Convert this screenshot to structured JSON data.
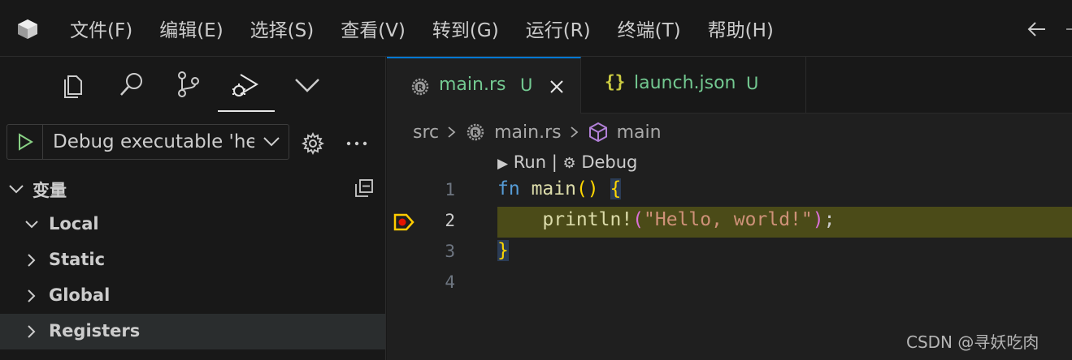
{
  "menu": [
    "文件(F)",
    "编辑(E)",
    "选择(S)",
    "查看(V)",
    "转到(G)",
    "运行(R)",
    "终端(T)",
    "帮助(H)"
  ],
  "icons": {
    "app": "vscode-cube-icon",
    "activity": [
      "explorer-icon",
      "search-icon",
      "source-control-icon",
      "run-debug-icon",
      "chevron-down-icon"
    ],
    "nav_back": "arrow-left-icon"
  },
  "debug": {
    "config_label": "Debug executable 'hello_world'",
    "play_color": "#89d185"
  },
  "variables": {
    "title": "变量",
    "items": [
      "Local",
      "Static",
      "Global",
      "Registers"
    ],
    "expanded": "Local",
    "selected": "Registers"
  },
  "tabs": [
    {
      "label": "main.rs",
      "status": "U",
      "icon": "rust-icon",
      "active": true
    },
    {
      "label": "launch.json",
      "status": "U",
      "icon": "json-braces-icon",
      "active": false
    }
  ],
  "breadcrumb": {
    "folder": "src",
    "file": "main.rs",
    "symbol": "main"
  },
  "codelens": {
    "run": "Run",
    "sep": "|",
    "debug": "Debug"
  },
  "code": {
    "line_numbers": [
      "1",
      "2",
      "3",
      "4"
    ],
    "current_line": 2,
    "breakpoint_line": 2,
    "lines": {
      "l1_kw": "fn",
      "l1_name": "main",
      "l1_parens": "()",
      "l1_brace": "{",
      "l2_macro": "println!",
      "l2_open": "(",
      "l2_str": "\"Hello, world!\"",
      "l2_close": ")",
      "l2_semi": ";",
      "l3_brace": "}"
    }
  },
  "colors": {
    "accent": "#0078d4",
    "untracked": "#73c991",
    "current_line_bg": "#4b4b18",
    "breakpoint": "#e51400"
  },
  "watermark": "CSDN @寻妖吃肉"
}
